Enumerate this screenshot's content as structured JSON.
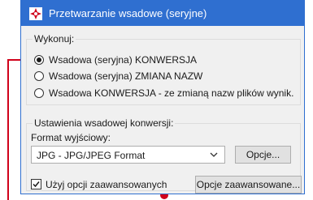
{
  "window": {
    "title": "Przetwarzanie wsadowe (seryjne)",
    "icon": "app-icon",
    "accent": "#2f6fd0"
  },
  "execute_group": {
    "legend": "Wykonuj:",
    "options": [
      {
        "label": "Wsadowa (seryjna) KONWERSJA",
        "selected": true
      },
      {
        "label": "Wsadowa (seryjna) ZMIANA NAZW",
        "selected": false
      },
      {
        "label": "Wsadowa  KONWERSJA - ze zmianą nazw plików wynik.",
        "selected": false
      }
    ]
  },
  "conversion_group": {
    "legend": "Ustawienia wsadowej konwersji:",
    "format_label": "Format wyjściowy:",
    "format_value": "JPG - JPG/JPEG Format",
    "options_button": "Opcje...",
    "advanced_checkbox_label": "Użyj opcji zaawansowanych",
    "advanced_checked": true,
    "advanced_button": "Opcje zaawansowane..."
  },
  "annotation": {
    "color": "#d0021b"
  }
}
